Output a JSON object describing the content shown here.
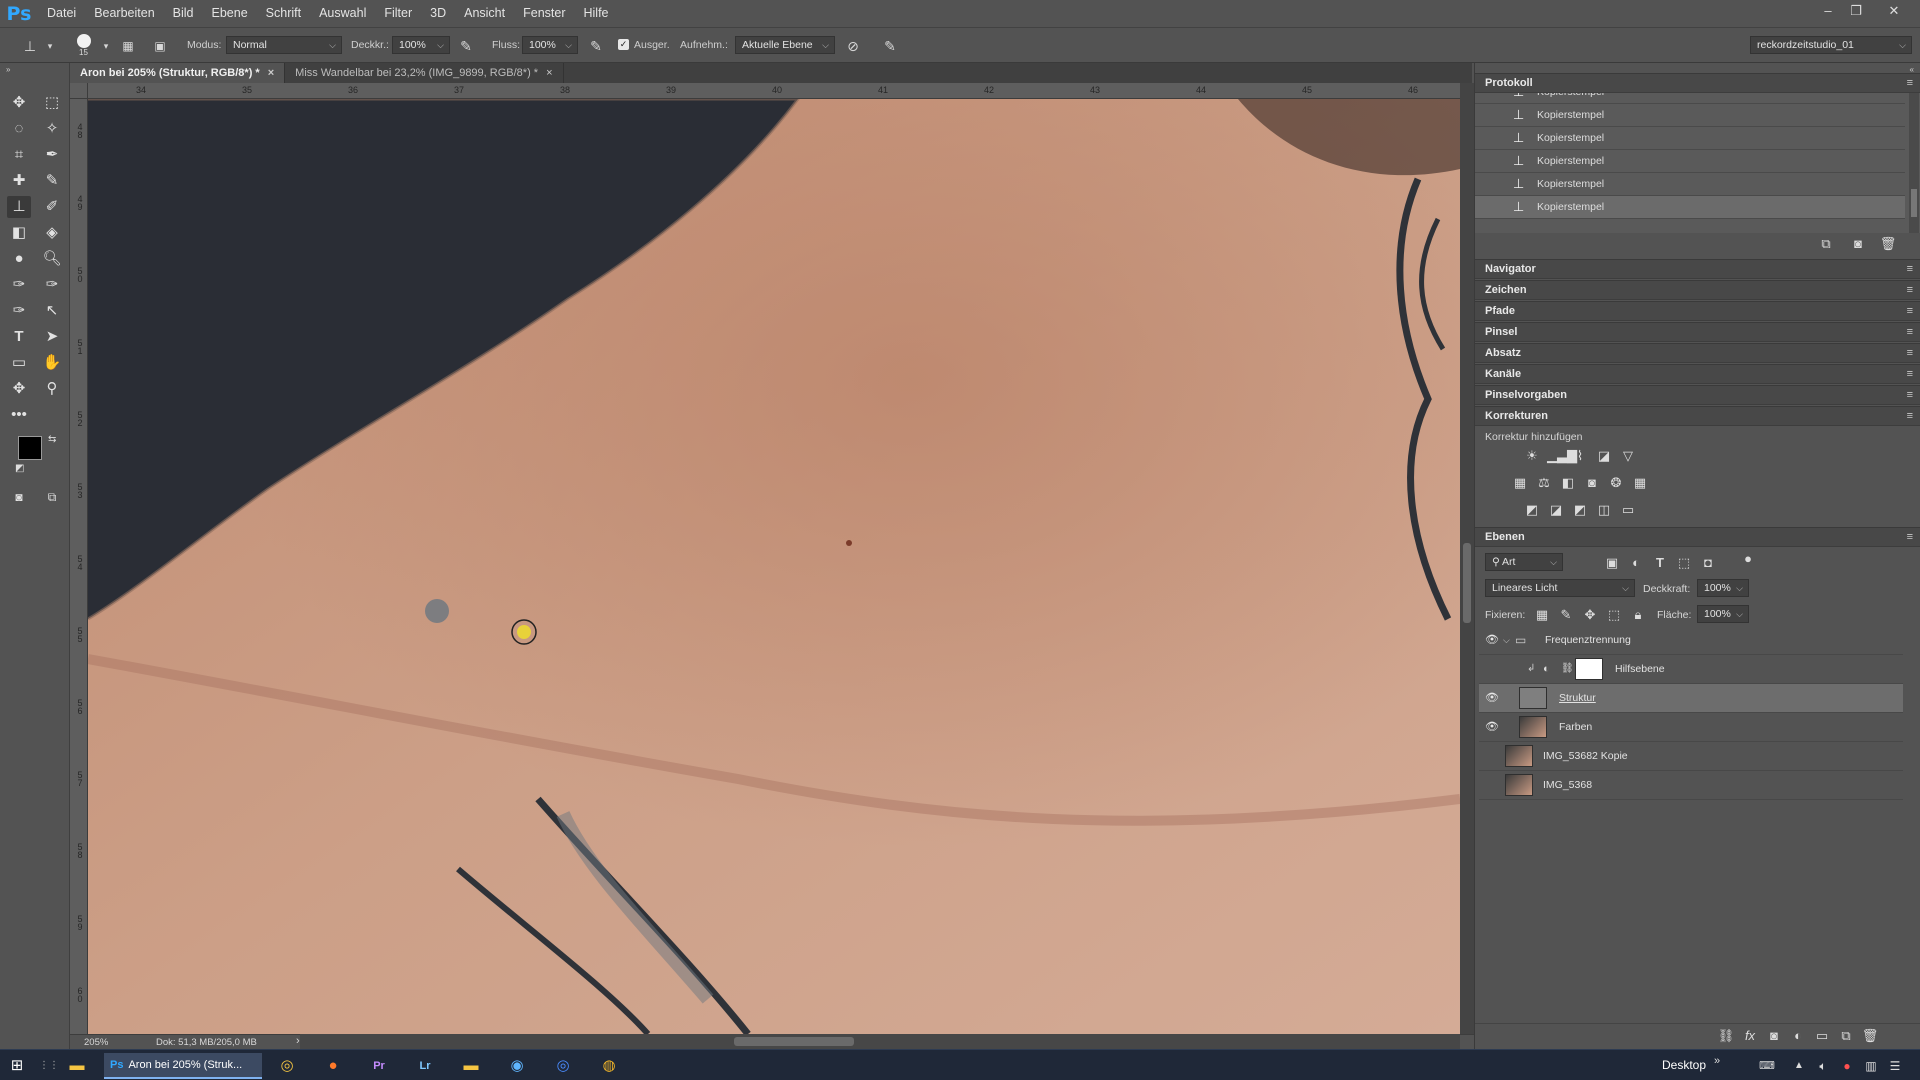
{
  "app": {
    "logo": "Ps",
    "accent": "#31a8ff"
  },
  "menu": [
    "Datei",
    "Bearbeiten",
    "Bild",
    "Ebene",
    "Schrift",
    "Auswahl",
    "Filter",
    "3D",
    "Ansicht",
    "Fenster",
    "Hilfe"
  ],
  "window_controls": {
    "minimize": "–",
    "restore": "❐",
    "close": "✕"
  },
  "options": {
    "brush_size": "15",
    "mode_label": "Modus:",
    "mode_value": "Normal",
    "opacity_label": "Deckkr.:",
    "opacity_value": "100%",
    "flow_label": "Fluss:",
    "flow_value": "100%",
    "aligned_label": "Ausger.",
    "sample_label": "Aufnehm.:",
    "sample_value": "Aktuelle Ebene",
    "workspace": "reckordzeitstudio_01"
  },
  "tabs": [
    {
      "label": "Aron bei 205% (Struktur, RGB/8*) *",
      "close": "×",
      "active": true
    },
    {
      "label": "Miss Wandelbar bei 23,2% (IMG_9899, RGB/8*) *",
      "close": "×",
      "active": false
    }
  ],
  "ruler_h": [
    "34",
    "35",
    "36",
    "37",
    "38",
    "39",
    "40",
    "41",
    "42",
    "43",
    "44",
    "45",
    "46"
  ],
  "ruler_v": [
    "4 8",
    "4 9",
    "5 0",
    "5 1",
    "5 2",
    "5 3",
    "5 4",
    "5 5",
    "5 6",
    "5 7",
    "5 8",
    "5 9",
    "6 0"
  ],
  "status": {
    "zoom": "205%",
    "doc": "Dok: 51,3 MB/205,0 MB",
    "arrow": "›"
  },
  "history": {
    "title": "Protokoll",
    "items": [
      "Kopierstempel",
      "Kopierstempel",
      "Kopierstempel",
      "Kopierstempel",
      "Kopierstempel",
      "Kopierstempel"
    ]
  },
  "collapsed_panels": [
    "Navigator",
    "Zeichen",
    "Pfade",
    "Pinsel",
    "Absatz",
    "Kanäle",
    "Pinselvorgaben"
  ],
  "adjustments": {
    "title": "Korrekturen",
    "subtitle": "Korrektur hinzufügen"
  },
  "layers": {
    "title": "Ebenen",
    "filter_label": "Art",
    "blend_mode": "Lineares Licht",
    "opacity_label": "Deckkraft:",
    "opacity_value": "100%",
    "lock_label": "Fixieren:",
    "fill_label": "Fläche:",
    "fill_value": "100%",
    "items": [
      {
        "name": "Frequenztrennung",
        "visible": true
      },
      {
        "name": "Hilfsebene",
        "visible": false
      },
      {
        "name": "Struktur",
        "visible": true
      },
      {
        "name": "Farben",
        "visible": true
      },
      {
        "name": "IMG_53682 Kopie",
        "visible": false
      },
      {
        "name": "IMG_5368",
        "visible": false
      }
    ]
  },
  "taskbar": {
    "active_app": "Aron bei 205% (Struk...",
    "desktop": "Desktop"
  },
  "icons": {
    "move": "move-icon",
    "marquee": "marquee-icon",
    "eye": "eye-icon",
    "menu": "panel-menu-icon"
  }
}
